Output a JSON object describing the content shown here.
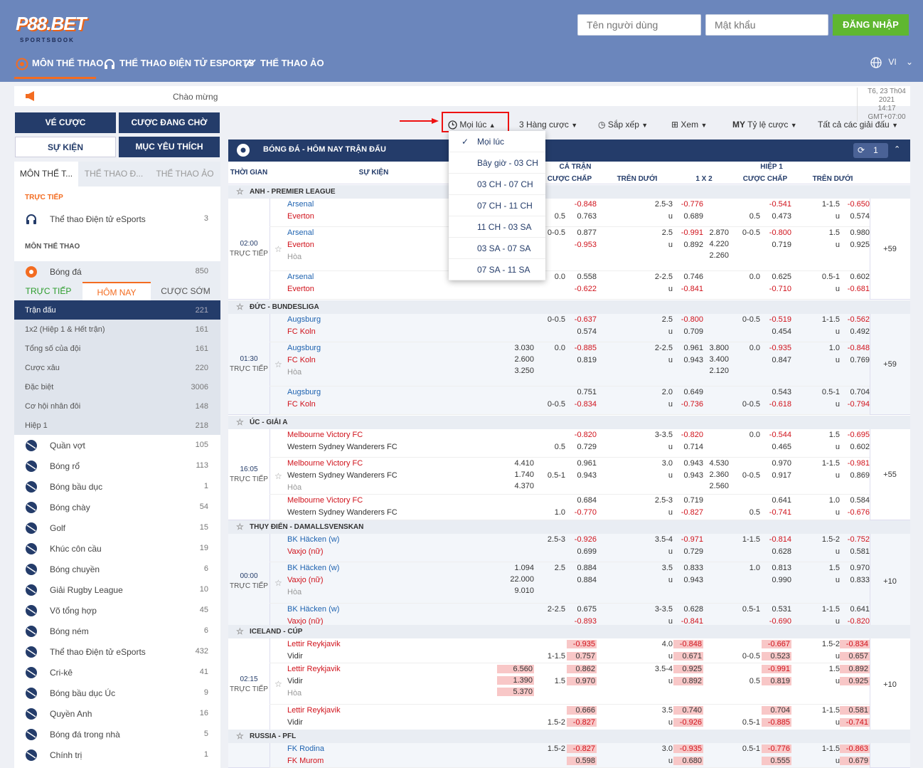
{
  "header": {
    "logo_text": "P88.BET",
    "logo_sub": "SPORTSBOOK",
    "username_placeholder": "Tên người dùng",
    "password_placeholder": "Mật khẩu",
    "login_label": "ĐĂNG NHẬP",
    "nav": [
      "MÔN THỂ THAO",
      "THỂ THAO ĐIỆN TỬ ESPORTS",
      "THỂ THAO ẢO"
    ],
    "lang": "VI"
  },
  "welcome": {
    "text": "Chào mừng",
    "date": "T6, 23 Th04 2021",
    "time": "14:17 GMT+07:00"
  },
  "buttons": {
    "bets": "VÉ CƯỢC",
    "pending": "CƯỢC ĐANG CHỜ",
    "events": "SỰ KIỆN",
    "favorites": "MỤC YÊU THÍCH"
  },
  "toolbar": {
    "time": "Mọi lúc",
    "markets": "3 Hàng cược",
    "sort": "Sắp xếp",
    "view": "Xem",
    "odds_prefix": "MY",
    "odds": "Tỷ lệ cược",
    "leagues": "Tất cả các giải đấu"
  },
  "dropdown": [
    "Mọi lúc",
    "Bây giờ - 03 CH",
    "03 CH - 07 CH",
    "07 CH - 11 CH",
    "11 CH - 03 SA",
    "03 SA - 07 SA",
    "07 SA - 11 SA"
  ],
  "sidebar": {
    "tabs": [
      "MÔN THỂ T...",
      "THỂ THAO Đ...",
      "THỂ THAO ẢO"
    ],
    "live_label": "TRỰC TIẾP",
    "esports_live": {
      "label": "Thể thao Điện tử eSports",
      "count": "3"
    },
    "sports_label": "MÔN THỂ THAO",
    "football": {
      "label": "Bóng đá",
      "count": "850"
    },
    "subtabs": [
      "TRỰC TIẾP",
      "HÔM NAY",
      "CƯỢC SỚM"
    ],
    "subitems": [
      {
        "label": "Trận đấu",
        "count": "221"
      },
      {
        "label": "1x2 (Hiệp 1 & Hết trận)",
        "count": "161"
      },
      {
        "label": "Tổng số của đội",
        "count": "161"
      },
      {
        "label": "Cược xâu",
        "count": "220"
      },
      {
        "label": "Đặc biệt",
        "count": "3006"
      },
      {
        "label": "Cơ hội nhân đôi",
        "count": "148"
      },
      {
        "label": "Hiệp 1",
        "count": "218"
      }
    ],
    "sports": [
      {
        "label": "Quần vợt",
        "count": "105"
      },
      {
        "label": "Bóng rổ",
        "count": "113"
      },
      {
        "label": "Bóng bầu dục",
        "count": "1"
      },
      {
        "label": "Bóng chày",
        "count": "54"
      },
      {
        "label": "Golf",
        "count": "15"
      },
      {
        "label": "Khúc côn cầu",
        "count": "19"
      },
      {
        "label": "Bóng chuyền",
        "count": "6"
      },
      {
        "label": "Giải Rugby League",
        "count": "10"
      },
      {
        "label": "Võ tổng hợp",
        "count": "45"
      },
      {
        "label": "Bóng ném",
        "count": "6"
      },
      {
        "label": "Thể thao Điện tử eSports",
        "count": "432"
      },
      {
        "label": "Cri-kê",
        "count": "41"
      },
      {
        "label": "Bóng bầu dục Úc",
        "count": "9"
      },
      {
        "label": "Quyền Anh",
        "count": "16"
      },
      {
        "label": "Bóng đá trong nhà",
        "count": "5"
      },
      {
        "label": "Chính trị",
        "count": "1"
      }
    ]
  },
  "main": {
    "title": "BÓNG ĐÁ - HÔM NAY TRẬN ĐẤU",
    "refresh_count": "1",
    "col_time": "THỜI GIAN",
    "col_event": "SỰ KIỆN",
    "full_match": "CẢ TRẬN",
    "half1": "HIỆP 1",
    "handicap": "CƯỢC CHẤP",
    "overunder": "TRÊN DƯỚI",
    "x12": "1 X 2",
    "live": "TRỰC TIẾP",
    "draw": "Hòa",
    "u": "u"
  },
  "leagues": [
    {
      "name": "ANH - PREMIER LEAGUE",
      "time": "02:00",
      "more": "+59",
      "home": "Arsenal",
      "away": "Everton",
      "home_red": false,
      "rows": [
        {
          "hc": [
            "",
            "0.5"
          ],
          "hco": [
            "-0.848",
            "0.763"
          ],
          "ou": [
            "2.5-3",
            "u"
          ],
          "ouo": [
            "-0.776",
            "0.689"
          ],
          "x": [],
          "h1hc": [
            "",
            "0.5"
          ],
          "h1hco": [
            "-0.541",
            "0.473"
          ],
          "h1ou": [
            "1-1.5",
            "u"
          ],
          "h1ouo": [
            "-0.650",
            "0.574"
          ]
        },
        {
          "x12": [],
          "hc": [
            "0-0.5",
            ""
          ],
          "hco": [
            "0.877",
            "-0.953"
          ],
          "ou": [
            "2.5",
            "u"
          ],
          "ouo": [
            "-0.991",
            "0.892"
          ],
          "x": [
            "2.870",
            "4.220",
            "2.260"
          ],
          "h1hc": [
            "0-0.5",
            ""
          ],
          "h1hco": [
            "-0.800",
            "0.719"
          ],
          "h1ou": [
            "1.5",
            "u"
          ],
          "h1ouo": [
            "0.980",
            "0.925"
          ]
        },
        {
          "hc": [
            "0.0",
            ""
          ],
          "hco": [
            "0.558",
            "-0.622"
          ],
          "ou": [
            "2-2.5",
            "u"
          ],
          "ouo": [
            "0.746",
            "-0.841"
          ],
          "x": [],
          "h1hc": [
            "0.0",
            ""
          ],
          "h1hco": [
            "0.625",
            "-0.710"
          ],
          "h1ou": [
            "0.5-1",
            "u"
          ],
          "h1ouo": [
            "0.602",
            "-0.681"
          ]
        }
      ]
    },
    {
      "name": "ĐỨC - BUNDESLIGA",
      "time": "01:30",
      "more": "+59",
      "home": "Augsburg",
      "away": "FC Koln",
      "home_red": false,
      "rows": [
        {
          "hc": [
            "0-0.5",
            ""
          ],
          "hco": [
            "-0.637",
            "0.574"
          ],
          "ou": [
            "2.5",
            "u"
          ],
          "ouo": [
            "-0.800",
            "0.709"
          ],
          "x": [],
          "h1hc": [
            "0-0.5",
            ""
          ],
          "h1hco": [
            "-0.519",
            "0.454"
          ],
          "h1ou": [
            "1-1.5",
            "u"
          ],
          "h1ouo": [
            "-0.562",
            "0.492"
          ]
        },
        {
          "x12": [
            "3.030",
            "2.600",
            "3.250"
          ],
          "hc": [
            "0.0",
            ""
          ],
          "hco": [
            "-0.885",
            "0.819"
          ],
          "ou": [
            "2-2.5",
            "u"
          ],
          "ouo": [
            "0.961",
            "0.943"
          ],
          "x": [
            "3.800",
            "3.400",
            "2.120"
          ],
          "h1hc": [
            "0.0",
            ""
          ],
          "h1hco": [
            "-0.935",
            "0.847"
          ],
          "h1ou": [
            "1.0",
            "u"
          ],
          "h1ouo": [
            "-0.848",
            "0.769"
          ]
        },
        {
          "hc": [
            "",
            "0-0.5"
          ],
          "hco": [
            "0.751",
            "-0.834"
          ],
          "ou": [
            "2.0",
            "u"
          ],
          "ouo": [
            "0.649",
            "-0.736"
          ],
          "x": [],
          "h1hc": [
            "",
            "0-0.5"
          ],
          "h1hco": [
            "0.543",
            "-0.618"
          ],
          "h1ou": [
            "0.5-1",
            "u"
          ],
          "h1ouo": [
            "0.704",
            "-0.794"
          ]
        }
      ]
    },
    {
      "name": "ÚC - GIẢI A",
      "time": "16:05",
      "more": "+55",
      "home": "Melbourne Victory FC",
      "away": "Western Sydney Wanderers FC",
      "home_red": true,
      "rows": [
        {
          "hc": [
            "",
            "0.5"
          ],
          "hco": [
            "-0.820",
            "0.729"
          ],
          "ou": [
            "3-3.5",
            "u"
          ],
          "ouo": [
            "-0.820",
            "0.714"
          ],
          "x": [],
          "h1hc": [
            "0.0",
            ""
          ],
          "h1hco": [
            "-0.544",
            "0.465"
          ],
          "h1ou": [
            "1.5",
            "u"
          ],
          "h1ouo": [
            "-0.695",
            "0.602"
          ]
        },
        {
          "x12": [
            "4.410",
            "1.740",
            "4.370"
          ],
          "hc": [
            "",
            "0.5-1"
          ],
          "hco": [
            "0.961",
            "0.943"
          ],
          "ou": [
            "3.0",
            "u"
          ],
          "ouo": [
            "0.943",
            "0.943"
          ],
          "x": [
            "4.530",
            "2.360",
            "2.560"
          ],
          "h1hc": [
            "",
            "0-0.5"
          ],
          "h1hco": [
            "0.970",
            "0.917"
          ],
          "h1ou": [
            "1-1.5",
            "u"
          ],
          "h1ouo": [
            "-0.981",
            "0.869"
          ]
        },
        {
          "hc": [
            "",
            "1.0"
          ],
          "hco": [
            "0.684",
            "-0.770"
          ],
          "ou": [
            "2.5-3",
            "u"
          ],
          "ouo": [
            "0.719",
            "-0.827"
          ],
          "x": [],
          "h1hc": [
            "",
            "0.5"
          ],
          "h1hco": [
            "0.641",
            "-0.741"
          ],
          "h1ou": [
            "1.0",
            "u"
          ],
          "h1ouo": [
            "0.584",
            "-0.676"
          ]
        }
      ]
    },
    {
      "name": "THỤY ĐIỂN - DAMALLSVENSKAN",
      "time": "00:00",
      "more": "+10",
      "home": "BK Häcken (w)",
      "away": "Vaxjo (nữ)",
      "home_red": false,
      "rows": [
        {
          "hc": [
            "2.5-3",
            ""
          ],
          "hco": [
            "-0.926",
            "0.699"
          ],
          "ou": [
            "3.5-4",
            "u"
          ],
          "ouo": [
            "-0.971",
            "0.729"
          ],
          "x": [],
          "h1hc": [
            "1-1.5",
            ""
          ],
          "h1hco": [
            "-0.814",
            "0.628"
          ],
          "h1ou": [
            "1.5-2",
            "u"
          ],
          "h1ouo": [
            "-0.752",
            "0.581"
          ]
        },
        {
          "x12": [
            "1.094",
            "22.000",
            "9.010"
          ],
          "hc": [
            "2.5",
            ""
          ],
          "hco": [
            "0.884",
            "0.884"
          ],
          "ou": [
            "3.5",
            "u"
          ],
          "ouo": [
            "0.833",
            "0.943"
          ],
          "x": [],
          "h1hc": [
            "1.0",
            ""
          ],
          "h1hco": [
            "0.813",
            "0.990"
          ],
          "h1ou": [
            "1.5",
            "u"
          ],
          "h1ouo": [
            "0.970",
            "0.833"
          ]
        },
        {
          "hc": [
            "2-2.5",
            ""
          ],
          "hco": [
            "0.675",
            "-0.893"
          ],
          "ou": [
            "3-3.5",
            "u"
          ],
          "ouo": [
            "0.628",
            "-0.841"
          ],
          "x": [],
          "h1hc": [
            "0.5-1",
            ""
          ],
          "h1hco": [
            "0.531",
            "-0.690"
          ],
          "h1ou": [
            "1-1.5",
            "u"
          ],
          "h1ouo": [
            "0.641",
            "-0.820"
          ]
        }
      ]
    },
    {
      "name": "ICELAND - CÚP",
      "time": "02:15",
      "more": "+10",
      "home": "Lettir Reykjavik",
      "away": "Vidir",
      "home_red": true,
      "rows": [
        {
          "hc": [
            "",
            "1-1.5"
          ],
          "hco": [
            "-0.935",
            "0.757"
          ],
          "ou": [
            "4.0",
            "u"
          ],
          "ouo": [
            "-0.848",
            "0.671"
          ],
          "x": [],
          "h1hc": [
            "",
            "0-0.5"
          ],
          "h1hco": [
            "-0.667",
            "0.523"
          ],
          "h1ou": [
            "1.5-2",
            "u"
          ],
          "h1ouo": [
            "-0.834",
            "0.657"
          ]
        },
        {
          "x12": [
            "6.560",
            "1.390",
            "5.370"
          ],
          "hc": [
            "",
            "1.5"
          ],
          "hco": [
            "0.862",
            "0.970"
          ],
          "ou": [
            "3.5-4",
            "u"
          ],
          "ouo": [
            "0.925",
            "0.892"
          ],
          "x": [],
          "h1hc": [
            "",
            "0.5"
          ],
          "h1hco": [
            "-0.991",
            "0.819"
          ],
          "h1ou": [
            "1.5",
            "u"
          ],
          "h1ouo": [
            "0.892",
            "0.925"
          ]
        },
        {
          "hc": [
            "",
            "1.5-2"
          ],
          "hco": [
            "0.666",
            "-0.827"
          ],
          "ou": [
            "3.5",
            "u"
          ],
          "ouo": [
            "0.740",
            "-0.926"
          ],
          "x": [],
          "h1hc": [
            "",
            "0.5-1"
          ],
          "h1hco": [
            "0.704",
            "-0.885"
          ],
          "h1ou": [
            "1-1.5",
            "u"
          ],
          "h1ouo": [
            "0.581",
            "-0.741"
          ]
        }
      ]
    },
    {
      "name": "RUSSIA - PFL",
      "time": "",
      "more": "",
      "home": "FK Rodina",
      "away": "FK Murom",
      "home_red": false,
      "rows": [
        {
          "hc": [
            "1.5-2",
            ""
          ],
          "hco": [
            "-0.827",
            "0.598"
          ],
          "ou": [
            "3.0",
            "u"
          ],
          "ouo": [
            "-0.935",
            "0.680"
          ],
          "x": [],
          "h1hc": [
            "0.5-1",
            ""
          ],
          "h1hco": [
            "-0.776",
            "0.555"
          ],
          "h1ou": [
            "1-1.5",
            "u"
          ],
          "h1ouo": [
            "-0.863",
            "0.679"
          ]
        }
      ]
    }
  ]
}
